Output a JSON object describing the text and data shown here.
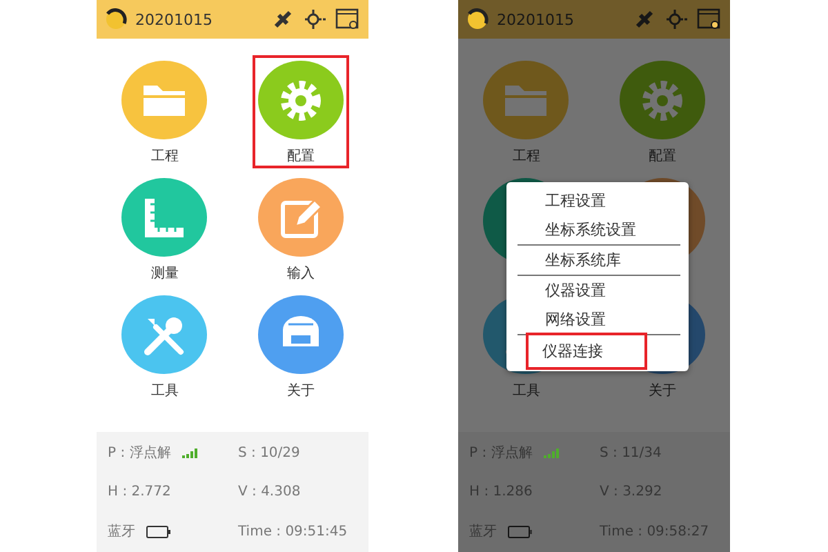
{
  "screens": [
    {
      "top_bar": {
        "date": "20201015"
      },
      "apps": [
        {
          "kind": "folder",
          "label": "工程",
          "color": "#f7c33f",
          "selected": false
        },
        {
          "kind": "gear",
          "label": "配置",
          "color": "#8bcb1d",
          "selected": true
        },
        {
          "kind": "ruler",
          "label": "测量",
          "color": "#21c79e",
          "selected": false
        },
        {
          "kind": "pencil",
          "label": "输入",
          "color": "#f9a65b",
          "selected": false
        },
        {
          "kind": "tools",
          "label": "工具",
          "color": "#4bc4ef",
          "selected": false
        },
        {
          "kind": "device",
          "label": "关于",
          "color": "#4f9ff0",
          "selected": false
        }
      ],
      "status": {
        "position": "P : 浮点解",
        "satellites": "S : 10/29",
        "h": "H : 2.772",
        "v": "V : 4.308",
        "bluetooth": "蓝牙",
        "time": "Time :  09:51:45"
      }
    },
    {
      "top_bar": {
        "date": "20201015"
      },
      "apps": [
        {
          "kind": "folder",
          "label": "工程",
          "color": "#6f581c",
          "selected": false
        },
        {
          "kind": "gear",
          "label": "配置",
          "color": "#3f5b0d",
          "selected": false
        },
        {
          "kind": "ruler",
          "color": "#0f5a47",
          "selected": false
        },
        {
          "kind": "pencil",
          "color": "#704b29",
          "selected": false
        },
        {
          "kind": "tools",
          "label": "工具",
          "color": "#22586c",
          "selected": false
        },
        {
          "kind": "device",
          "label": "关于",
          "color": "#24486c",
          "selected": false
        }
      ],
      "status": {
        "position": "P : 浮点解",
        "satellites": "S : 11/34",
        "h": "H : 1.286",
        "v": "V : 3.292",
        "bluetooth": "蓝牙",
        "time": "Time :  09:58:27"
      },
      "menu": {
        "items": [
          {
            "label": "工程设置",
            "separated": false,
            "selected": false
          },
          {
            "label": "坐标系统设置",
            "separated": true,
            "selected": false
          },
          {
            "label": "坐标系统库",
            "separated": true,
            "selected": false
          },
          {
            "label": "仪器设置",
            "separated": false,
            "selected": false
          },
          {
            "label": "网络设置",
            "separated": true,
            "selected": false
          },
          {
            "label": "仪器连接",
            "separated": false,
            "selected": true
          }
        ]
      }
    }
  ]
}
